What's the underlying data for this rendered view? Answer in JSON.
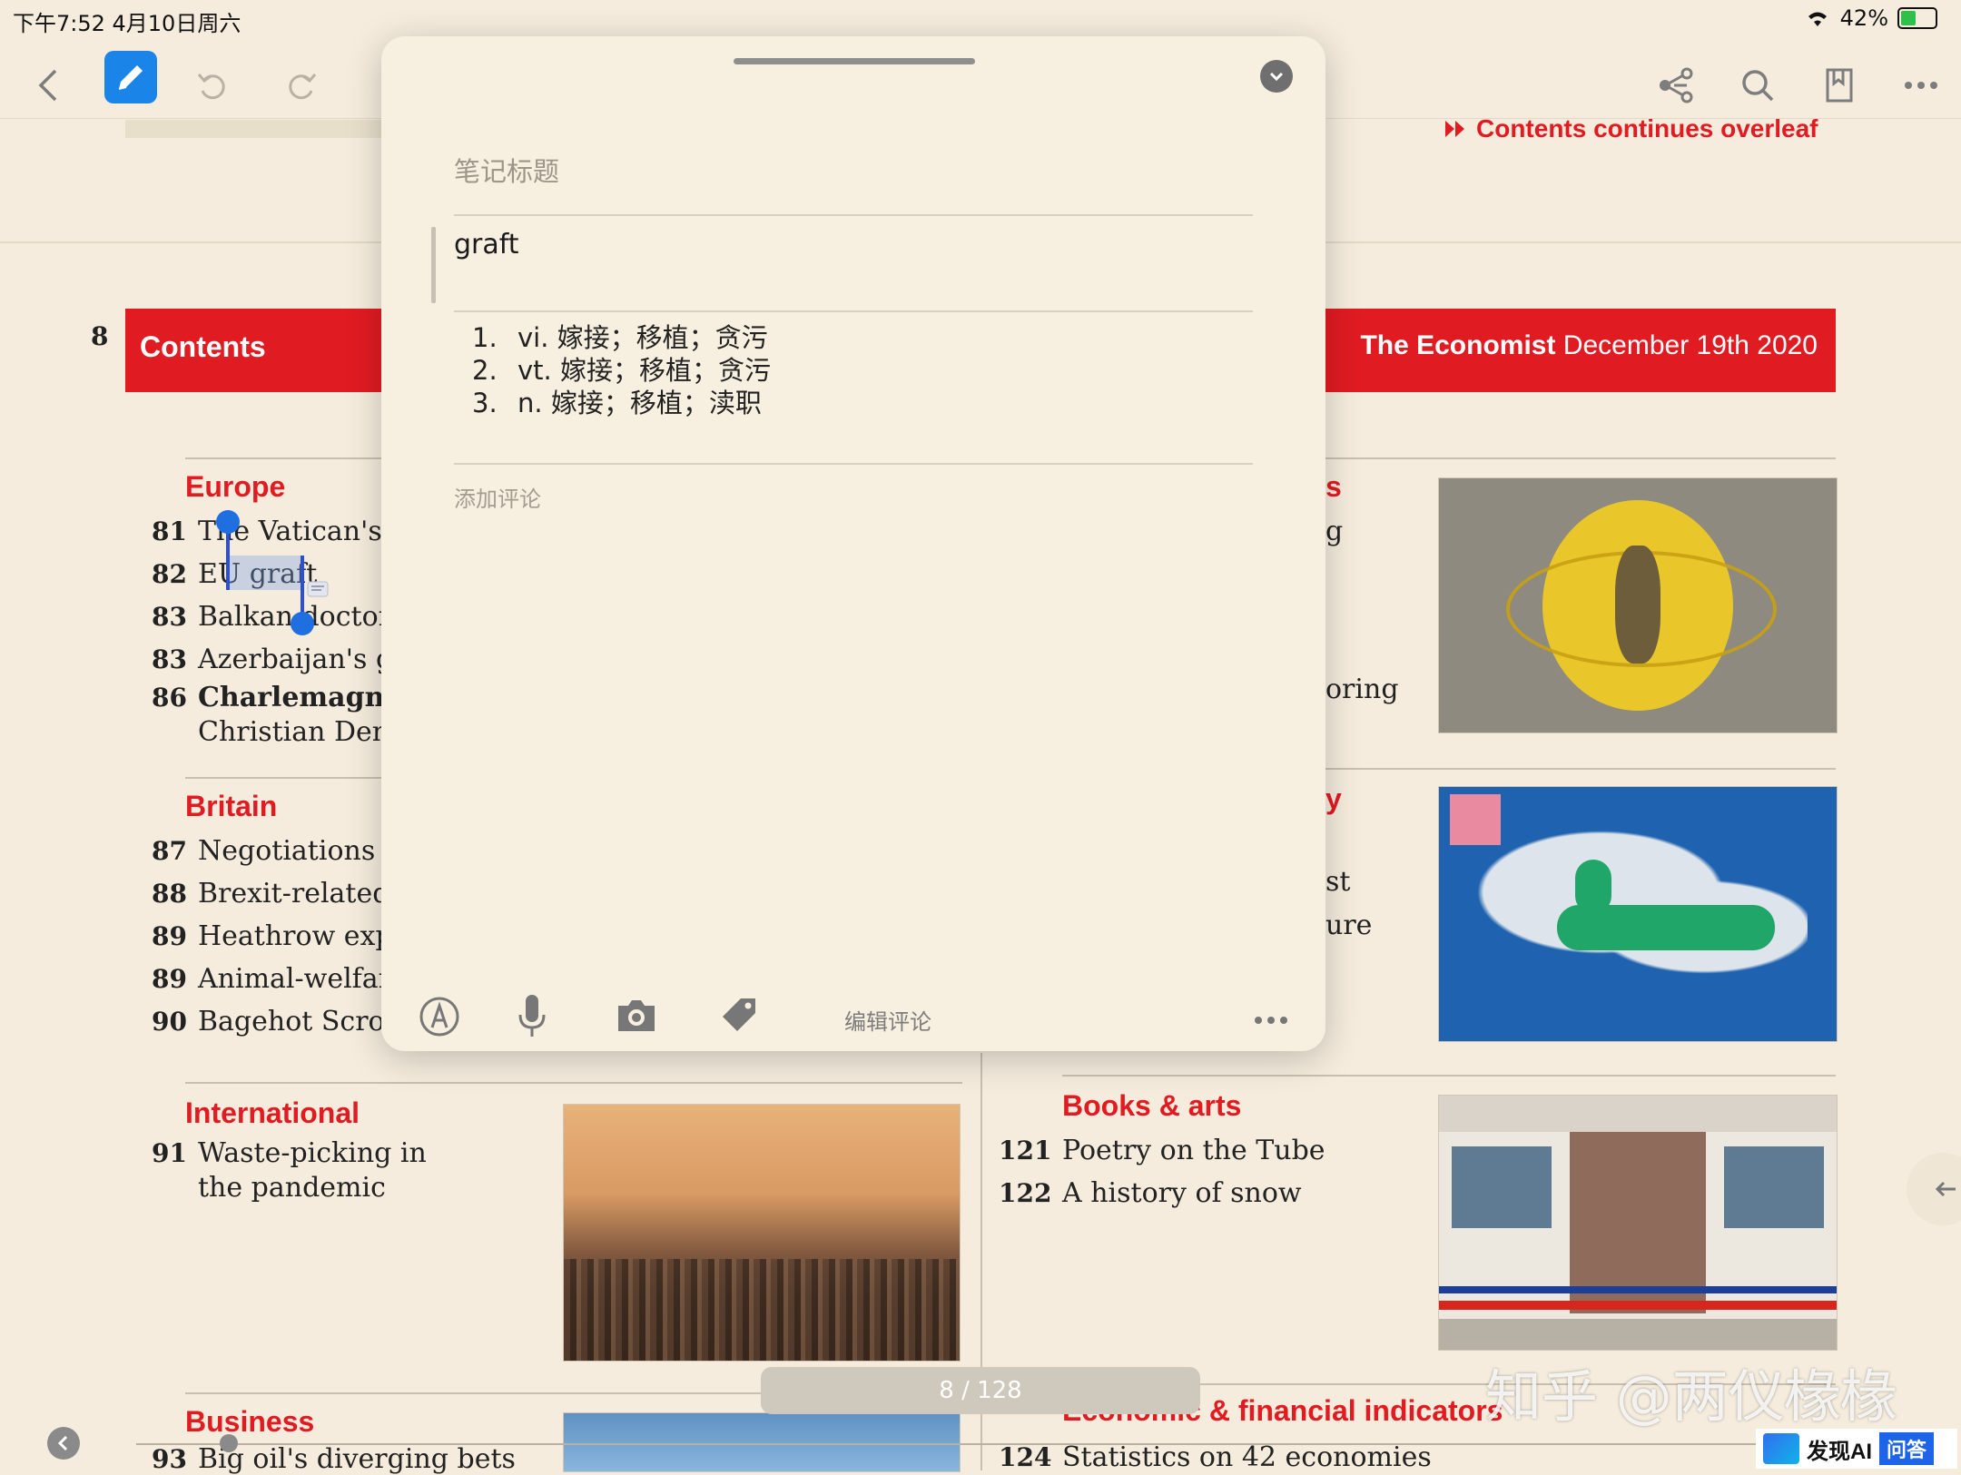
{
  "status_bar": {
    "time_date": "下午7:52   4月10日周六",
    "battery": "42%"
  },
  "toolbar": {
    "icons": [
      "back-icon",
      "pencil-icon",
      "undo-icon",
      "redo-icon",
      "share-icon",
      "search-icon",
      "bookmark-icon",
      "more-icon"
    ]
  },
  "page_header": {
    "continues": "Contents continues overleaf",
    "page_number": "8",
    "contents_label": "Contents",
    "masthead": "The Economist",
    "masthead_date": "December 19th 2020"
  },
  "left_column": {
    "europe": {
      "heading": "Europe",
      "items": [
        {
          "num": "81",
          "text": "The Vatican's fi"
        },
        {
          "num": "82",
          "text": "EU graft"
        },
        {
          "num": "83",
          "text": "Balkan doctors"
        },
        {
          "num": "83",
          "text": "Azerbaijan's gh"
        },
        {
          "num": "86",
          "text": "Charlemagne T"
        },
        {
          "num": "",
          "text": "Christian Demo"
        }
      ]
    },
    "britain": {
      "heading": "Britain",
      "items": [
        {
          "num": "87",
          "text": "Negotiations w"
        },
        {
          "num": "88",
          "text": "Brexit-related d"
        },
        {
          "num": "89",
          "text": "Heathrow expa"
        },
        {
          "num": "89",
          "text": "Animal-welfare"
        },
        {
          "num": "90",
          "text": "Bagehot Scroog"
        }
      ]
    },
    "international": {
      "heading": "International",
      "num": "91",
      "line1": "Waste-picking in",
      "line2": "the pandemic"
    },
    "business": {
      "heading": "Business",
      "num": "93",
      "text": "Big oil's diverging bets"
    }
  },
  "right_column": {
    "peek_texts": [
      "s",
      "g",
      "oring",
      "y",
      "st",
      "ure"
    ],
    "books": {
      "heading": "Books & arts",
      "items": [
        {
          "num": "121",
          "text": "Poetry on the Tube"
        },
        {
          "num": "122",
          "text": "A history of snow"
        }
      ]
    },
    "indicators": {
      "heading": "Economic & financial indicators",
      "num": "124",
      "text": "Statistics on 42 economies"
    }
  },
  "popup": {
    "title_placeholder": "笔记标题",
    "word": "graft",
    "definitions": [
      {
        "n": "1.",
        "text": "vi. 嫁接；移植；贪污"
      },
      {
        "n": "2.",
        "text": "vt. 嫁接；移植；贪污"
      },
      {
        "n": "3.",
        "text": "n. 嫁接；移植；渎职"
      }
    ],
    "comment_placeholder": "添加评论",
    "edit_comment": "编辑评论",
    "bottom_icons": [
      "pen-circle-icon",
      "microphone-icon",
      "camera-icon",
      "tag-icon",
      "more-icon"
    ]
  },
  "page_indicator": "8 / 128",
  "watermark": "知乎 @两仪椽椽",
  "badge": {
    "brand": "发现AI",
    "sub": "问答"
  }
}
